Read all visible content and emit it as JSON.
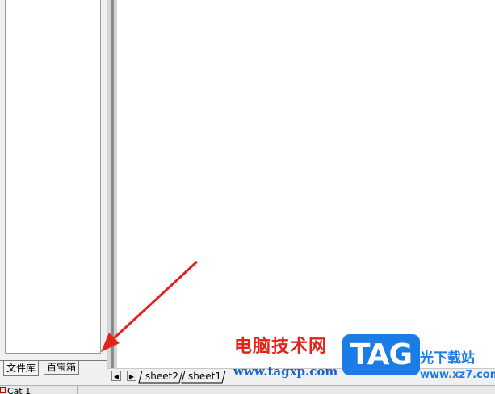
{
  "left_panel": {
    "tabs": [
      {
        "label": "文件库",
        "active": true
      },
      {
        "label": "百宝箱",
        "active": false
      }
    ]
  },
  "sheet_bar": {
    "nav_prev_icon": "triangle-left-icon",
    "nav_next_icon": "triangle-right-icon",
    "tabs": [
      {
        "label": "sheet2"
      },
      {
        "label": "sheet1"
      }
    ]
  },
  "status_bar": {
    "item_label": "Cat 1",
    "icon": "page-icon"
  },
  "watermark": {
    "site_cn": "电脑技术网",
    "site_url": "www.tagxp.com",
    "logo_text": "TAG",
    "logo_site_cn": "光下载站",
    "logo_site_url": "www.xz7.com"
  },
  "annotation": {
    "arrow_color": "#e3231c"
  },
  "colors": {
    "watermark_red": "#e3231c",
    "watermark_blue": "#1e64c8",
    "logo_blue": "#1c7ce6"
  }
}
